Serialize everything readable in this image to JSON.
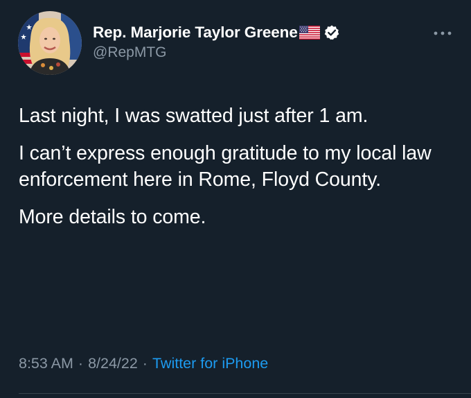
{
  "author": {
    "display_name": "Rep. Marjorie Taylor Greene",
    "handle": "@RepMTG",
    "flag_icon": "us-flag-icon",
    "verified_icon": "verified-badge-icon"
  },
  "tweet": {
    "paragraphs": [
      "Last night, I was swatted just after 1 am.",
      "I can’t express enough gratitude to my local law enforcement here in Rome, Floyd County.",
      "More details to come."
    ]
  },
  "meta": {
    "time": "8:53 AM",
    "separator": "·",
    "date": "8/24/22",
    "source": "Twitter for iPhone"
  },
  "colors": {
    "background": "#15202b",
    "primary_text": "#ffffff",
    "secondary_text": "#8b98a5",
    "link": "#1d9bf0",
    "divider": "#38444d"
  }
}
